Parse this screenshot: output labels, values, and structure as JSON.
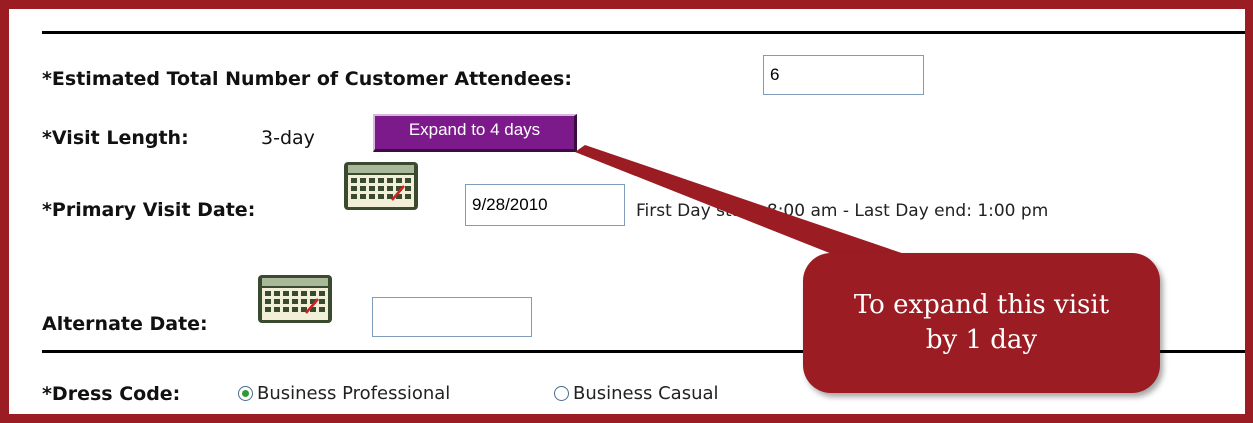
{
  "form": {
    "attendees_label": "*Estimated Total Number of Customer Attendees:",
    "attendees_value": "6",
    "visit_length_label": "*Visit Length:",
    "visit_length_value": "3-day",
    "expand_button": "Expand to 4 days",
    "primary_date_label": "*Primary Visit Date:",
    "primary_date_value": "9/28/2010",
    "day_times": "First Day start: 8:00 am - Last Day end: 1:00 pm",
    "alternate_date_label": "Alternate Date:",
    "alternate_date_value": "",
    "dress_code_label": "*Dress Code:",
    "dress_code_options": [
      "Business Professional",
      "Business Casual"
    ],
    "dress_code_selected": "Business Professional"
  },
  "callout": {
    "text": "To expand this visit by 1 day"
  },
  "icons": {
    "calendar": "calendar-icon",
    "radio_checked": "radio-checked-icon",
    "radio_unchecked": "radio-unchecked-icon"
  },
  "colors": {
    "frame": "#9b1c22",
    "button": "#7d1a8b",
    "callout": "#9b1c22"
  }
}
